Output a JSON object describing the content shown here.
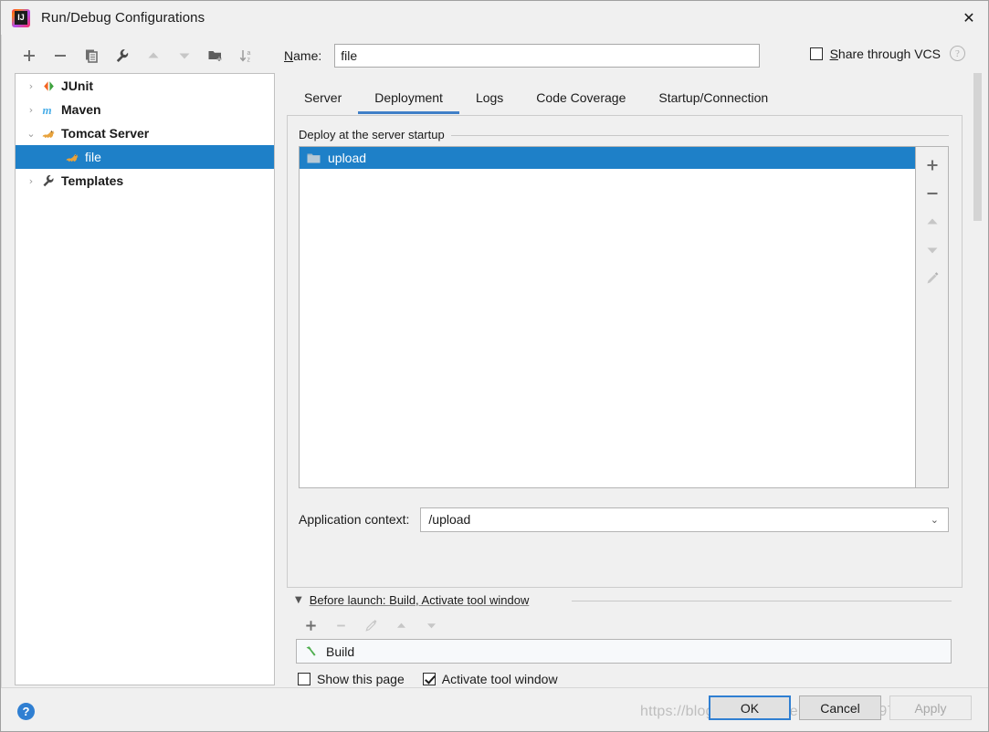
{
  "window": {
    "title": "Run/Debug Configurations",
    "app_icon": "intellij-idea-icon",
    "close_label": "✕"
  },
  "left_toolbar": {
    "buttons": [
      {
        "name": "add-configuration-button",
        "icon": "plus-icon",
        "label": "+",
        "enabled": true
      },
      {
        "name": "remove-configuration-button",
        "icon": "minus-icon",
        "label": "−",
        "enabled": true
      },
      {
        "name": "copy-configuration-button",
        "icon": "copy-icon",
        "label": "Copy",
        "enabled": true
      },
      {
        "name": "edit-templates-button",
        "icon": "wrench-icon",
        "label": "Edit Templates",
        "enabled": true
      },
      {
        "name": "move-up-button",
        "icon": "arrow-up-icon",
        "label": "Move Up",
        "enabled": false
      },
      {
        "name": "move-down-button",
        "icon": "arrow-down-icon",
        "label": "Move Down",
        "enabled": false
      },
      {
        "name": "new-folder-button",
        "icon": "new-folder-icon",
        "label": "New Folder",
        "enabled": true
      },
      {
        "name": "sort-alphabetically-button",
        "icon": "sort-az-icon",
        "label": "Sort Alphabetically",
        "enabled": true
      }
    ]
  },
  "tree": {
    "items": [
      {
        "label": "JUnit",
        "icon": "junit-icon",
        "expander": "›",
        "level": 0,
        "selected": false
      },
      {
        "label": "Maven",
        "icon": "maven-icon",
        "expander": "›",
        "level": 0,
        "selected": false
      },
      {
        "label": "Tomcat Server",
        "icon": "tomcat-icon",
        "expander": "⌄",
        "level": 0,
        "selected": false
      },
      {
        "label": "file",
        "icon": "tomcat-icon",
        "expander": "",
        "level": 1,
        "selected": true
      },
      {
        "label": "Templates",
        "icon": "wrench-icon",
        "expander": "›",
        "level": 0,
        "selected": false
      }
    ]
  },
  "name_field": {
    "label": "Name:",
    "label_mnemonic": "N",
    "label_rest": "ame:",
    "value": "file",
    "placeholder": ""
  },
  "share_vcs": {
    "label_mnemonic": "S",
    "label_rest": "hare through VCS",
    "checked": false,
    "help_icon": "question-mark-icon",
    "help_glyph": "?"
  },
  "tabs": [
    {
      "label": "Server",
      "active": false
    },
    {
      "label": "Deployment",
      "active": true
    },
    {
      "label": "Logs",
      "active": false
    },
    {
      "label": "Code Coverage",
      "active": false
    },
    {
      "label": "Startup/Connection",
      "active": false
    }
  ],
  "deployment": {
    "group_label": "Deploy at the server startup",
    "artifacts": [
      {
        "label": "upload",
        "icon": "folder-icon",
        "selected": true
      }
    ],
    "side_buttons": [
      {
        "name": "add-artifact-button",
        "icon": "plus-icon",
        "label": "+",
        "enabled": true
      },
      {
        "name": "remove-artifact-button",
        "icon": "minus-icon",
        "label": "−",
        "enabled": true
      },
      {
        "name": "move-artifact-up-button",
        "icon": "arrow-up-icon",
        "label": "Move Up",
        "enabled": false
      },
      {
        "name": "move-artifact-down-button",
        "icon": "arrow-down-icon",
        "label": "Move Down",
        "enabled": false
      },
      {
        "name": "edit-artifact-button",
        "icon": "pencil-icon",
        "label": "Edit",
        "enabled": false
      }
    ],
    "application_context": {
      "label": "Application context:",
      "value": "/upload",
      "arrow_glyph": "⌄"
    }
  },
  "before_launch": {
    "triangle_glyph": "▼",
    "title": "Before launch: Build, Activate tool window",
    "toolbar": [
      {
        "name": "add-task-button",
        "icon": "plus-icon",
        "label": "+",
        "enabled": true
      },
      {
        "name": "remove-task-button",
        "icon": "minus-icon",
        "label": "−",
        "enabled": false
      },
      {
        "name": "edit-task-button",
        "icon": "pencil-icon",
        "label": "Edit",
        "enabled": false
      },
      {
        "name": "task-move-up-button",
        "icon": "arrow-up-icon",
        "label": "Move Up",
        "enabled": false
      },
      {
        "name": "task-move-down-button",
        "icon": "arrow-down-icon",
        "label": "Move Down",
        "enabled": false
      }
    ],
    "tasks": [
      {
        "label": "Build",
        "icon": "build-hammer-icon"
      }
    ],
    "checkboxes": [
      {
        "label": "Show this page",
        "checked": false,
        "name": "show-this-page-checkbox"
      },
      {
        "label": "Activate tool window",
        "checked": true,
        "name": "activate-tool-window-checkbox"
      }
    ]
  },
  "footer": {
    "help_glyph": "?",
    "buttons": [
      {
        "label": "OK",
        "name": "ok-button",
        "state": "focused"
      },
      {
        "label": "Cancel",
        "name": "cancel-button",
        "state": "normal"
      },
      {
        "label": "Apply",
        "name": "apply-button",
        "state": "disabled"
      }
    ],
    "watermark": "https://blog.csdn.net/weixin_46044097"
  },
  "colors": {
    "selection_blue": "#1e80c8",
    "accent_blue": "#2f7fd2",
    "tab_underline": "#4080c8",
    "dialog_bg": "#f0f0f0",
    "field_bg": "#ffffff"
  }
}
